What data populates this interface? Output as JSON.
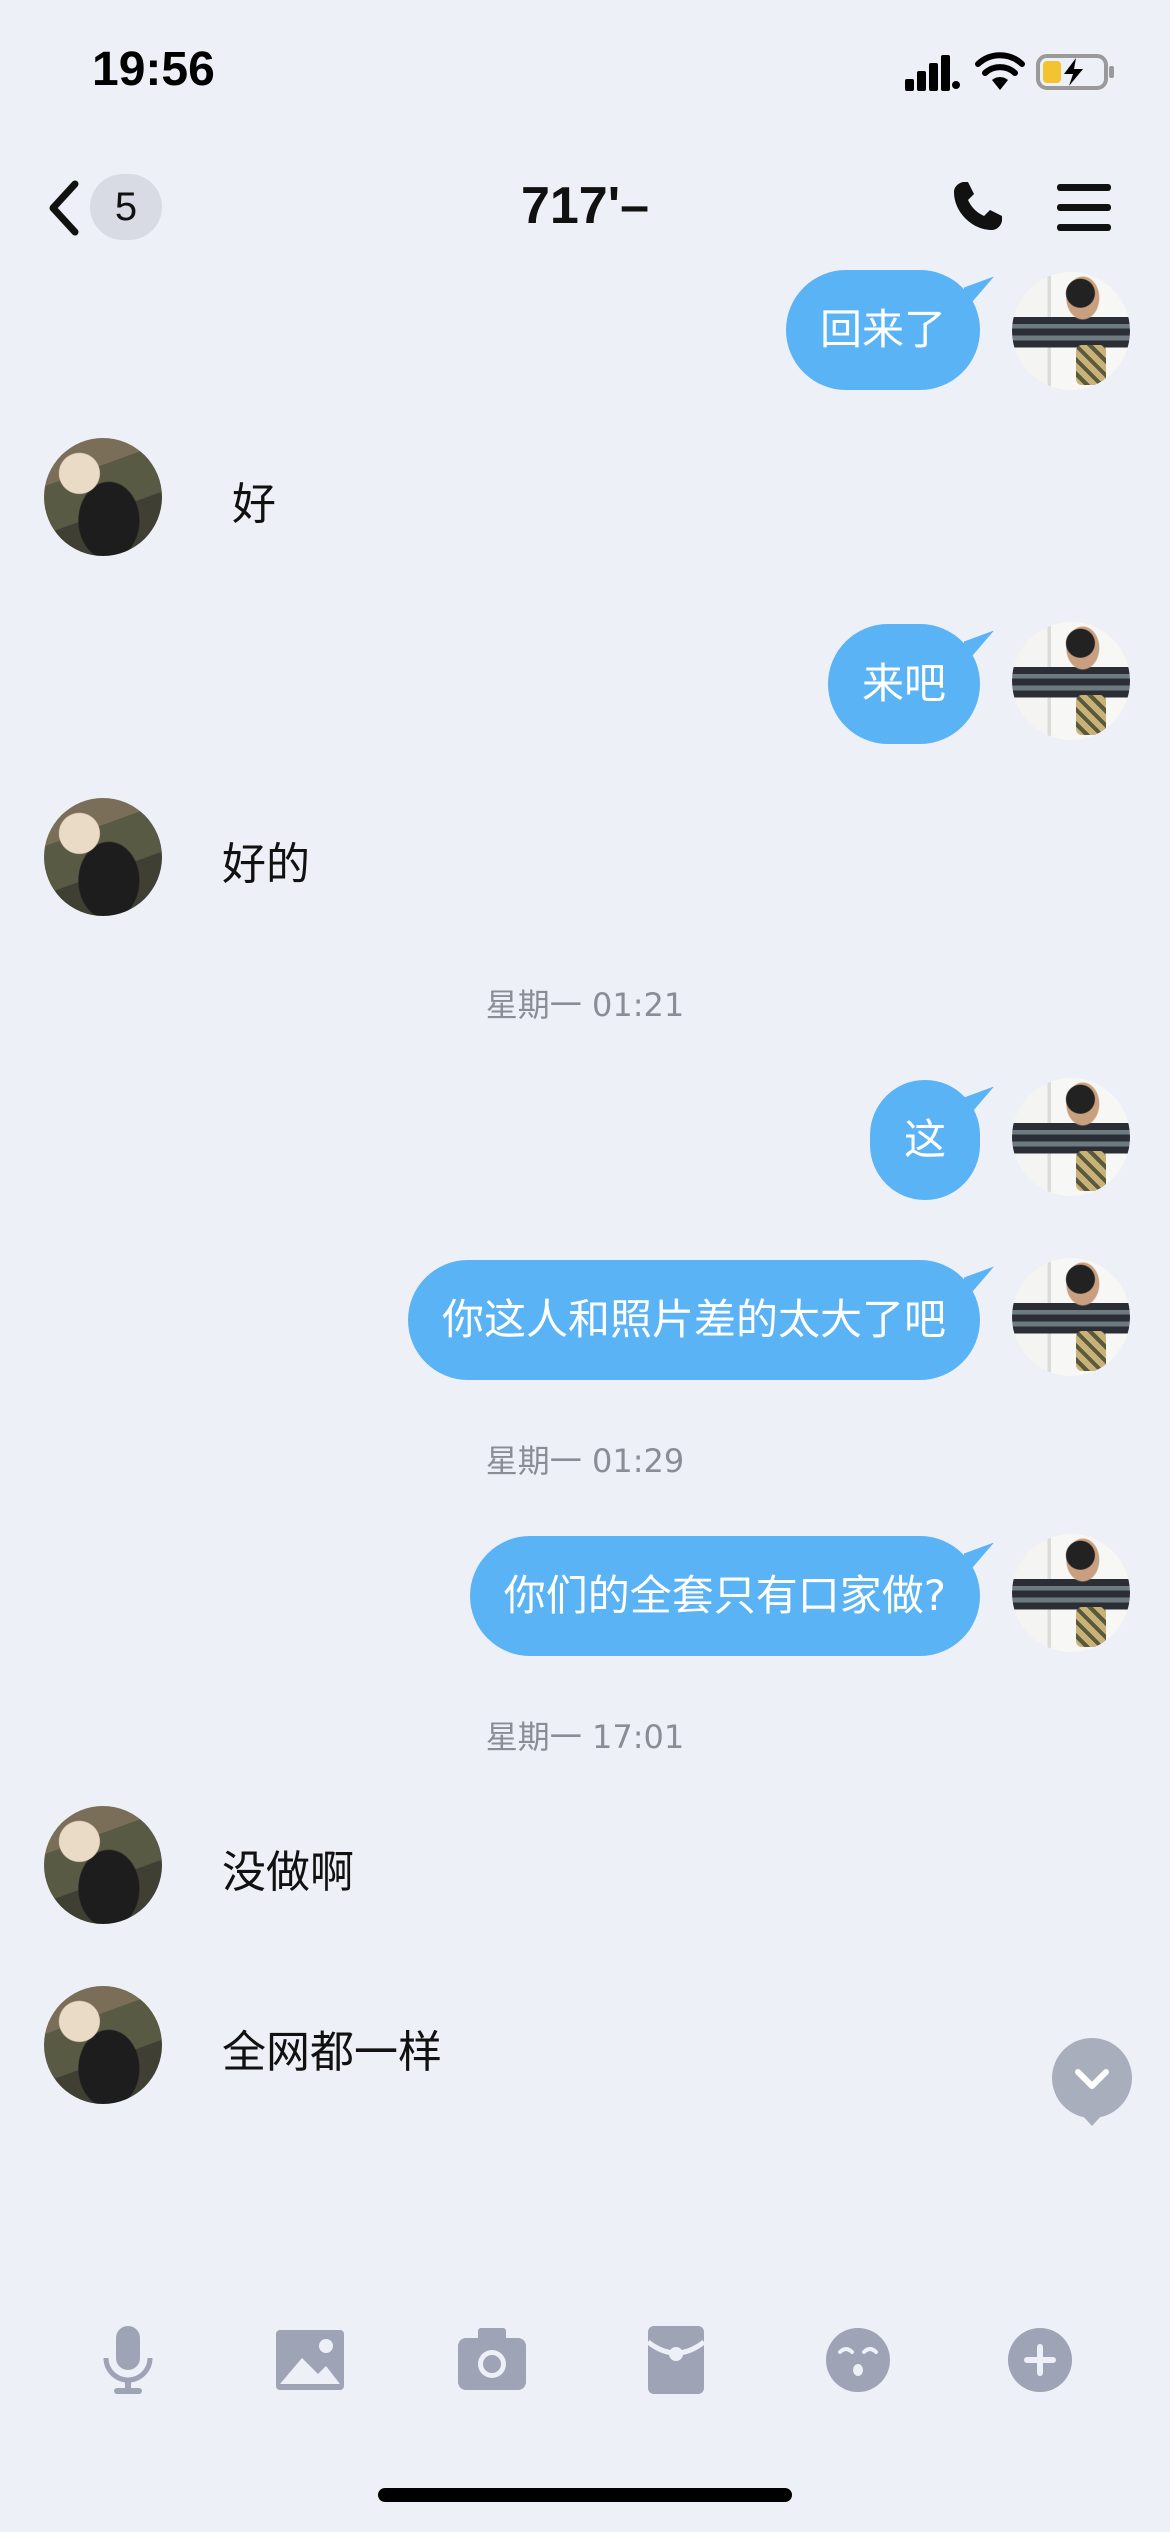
{
  "status_bar": {
    "time": "19:56"
  },
  "nav": {
    "badge": "5",
    "title": "717'–"
  },
  "messages": [
    {
      "id": "m1",
      "side": "out",
      "text": "回来了"
    },
    {
      "id": "m2",
      "side": "in",
      "text": "好"
    },
    {
      "id": "m3",
      "side": "out",
      "text": "来吧"
    },
    {
      "id": "m4",
      "side": "in",
      "text": "好的"
    },
    {
      "id": "t1",
      "type": "time",
      "text": "星期一 01:21"
    },
    {
      "id": "m5",
      "side": "out",
      "text": "这"
    },
    {
      "id": "m6",
      "side": "out",
      "text": "你这人和照片差的太大了吧"
    },
    {
      "id": "t2",
      "type": "time",
      "text": "星期一 01:29"
    },
    {
      "id": "m7",
      "side": "out",
      "text": "你们的全套只有口家做?"
    },
    {
      "id": "t3",
      "type": "time",
      "text": "星期一 17:01"
    },
    {
      "id": "m8",
      "side": "in",
      "text": "没做啊"
    },
    {
      "id": "m9",
      "side": "in",
      "text": "全网都一样"
    }
  ],
  "toolbar": {
    "icons": [
      "microphone-icon",
      "image-icon",
      "camera-icon",
      "red-packet-icon",
      "emoji-icon",
      "plus-icon"
    ]
  },
  "colors": {
    "bubble_out": "#5ab3f5",
    "background": "#eef0f7",
    "toolbar_icon": "#9ea3b5"
  }
}
